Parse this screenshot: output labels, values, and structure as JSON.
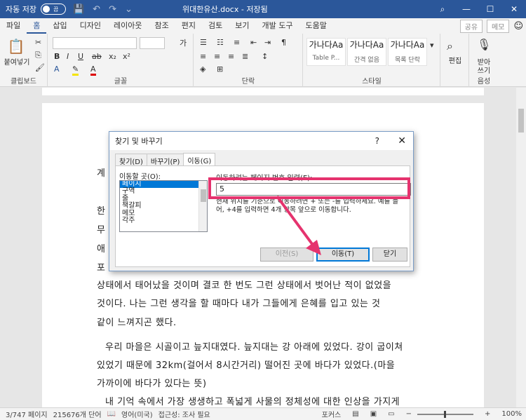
{
  "titlebar": {
    "autosave_label": "자동 저장",
    "toggle_label": "끔",
    "doc_title": "위대한유산.docx - 저장됨",
    "search_icon": "search-icon",
    "min": "—",
    "max": "☐",
    "close": "✕"
  },
  "tabs": [
    {
      "label": "파일"
    },
    {
      "label": "홈"
    },
    {
      "label": "삽입"
    },
    {
      "label": "디자인"
    },
    {
      "label": "레이아웃"
    },
    {
      "label": "참조"
    },
    {
      "label": "편지"
    },
    {
      "label": "검토"
    },
    {
      "label": "보기"
    },
    {
      "label": "개발 도구"
    },
    {
      "label": "도움말"
    }
  ],
  "tab_right": {
    "share": "공유",
    "memo": "메모"
  },
  "ribbon": {
    "clipboard": {
      "paste": "붙여넣기",
      "label": "클립보드"
    },
    "font": {
      "label": "글꼴",
      "grow": "가"
    },
    "paragraph": {
      "label": "단락"
    },
    "styles": {
      "label": "스타일",
      "items": [
        {
          "sample": "가나다Aa",
          "name": "Table P..."
        },
        {
          "sample": "가나다Aa",
          "name": "간격 없음"
        },
        {
          "sample": "가나다Aa",
          "name": "목록 단락"
        }
      ]
    },
    "editing": {
      "label": "편집"
    },
    "voice": {
      "dictate": "받아",
      "dictate2": "쓰기",
      "label": "음성"
    }
  },
  "document": {
    "lines": [
      "계",
      "한",
      "무",
      "애",
      "포",
      "상태에서 태어났을 것이며 결코 한 번도 그런 상태에서 벗어난 적이 없었을",
      "것이다. 나는 그런 생각을 할 때마다 내가 그들에게 은혜를 입고 있는 것",
      "같이 느껴지곤 했다.",
      "우리 마을은 시골이고 늪지대였다. 늪지대는 강 아래에 있었다. 강이 굽이쳐",
      "있었기 때문에 32km(걸어서 8시간거리) 떨어진 곳에 바다가 있었다.(마을",
      "가까이에 바다가 있다는 뜻)",
      "내 기억 속에서 가장 생생하고 폭넓게 사물의 정체성에 대한 인상을 가지게"
    ]
  },
  "dialog": {
    "title": "찾기 및 바꾸기",
    "help": "?",
    "close": "✕",
    "tabs": [
      {
        "label": "찾기(D)"
      },
      {
        "label": "바꾸기(P)"
      },
      {
        "label": "이동(G)"
      }
    ],
    "goto_label": "이동할 곳(O):",
    "goto_items": [
      {
        "label": "페이지"
      },
      {
        "label": "구역"
      },
      {
        "label": "줄"
      },
      {
        "label": "책갈피"
      },
      {
        "label": "메모"
      },
      {
        "label": "각주"
      }
    ],
    "page_label": "이동하려는 페이지 번호 입력(E):",
    "page_value": "5",
    "hint": "현재 위치를 기준으로 이동하려면 + 또는 -를 입력하세요. 예를 들어, +4를 입력하면 4개 항목 앞으로 이동합니다.",
    "prev_button": "이전(S)",
    "goto_button": "이동(T)",
    "close_button": "닫기"
  },
  "statusbar": {
    "page": "3/747 페이지",
    "words": "215676개 단어",
    "lang": "영어(미국)",
    "access": "접근성: 조사 필요",
    "focus": "포커스",
    "zoom": "100%"
  },
  "colors": {
    "accent": "#2b579a",
    "annotation": "#e5336e",
    "select": "#0078d7"
  }
}
